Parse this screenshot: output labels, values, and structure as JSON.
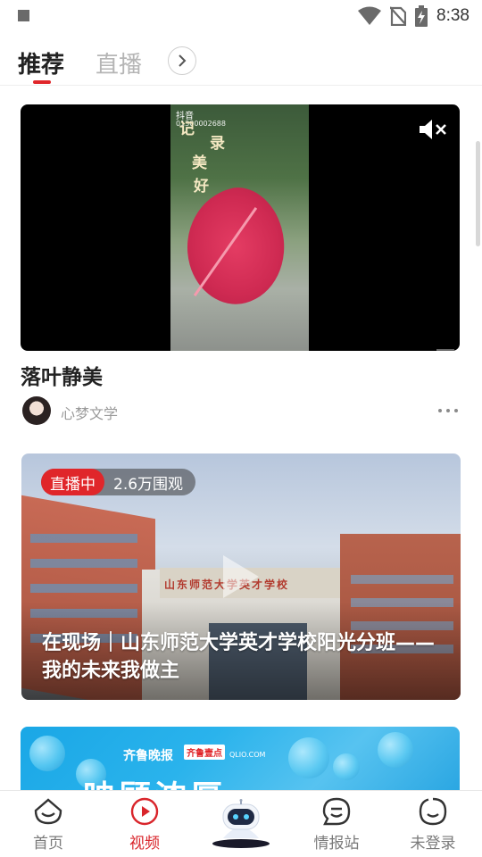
{
  "status_bar": {
    "time": "8:38"
  },
  "tabs": [
    {
      "label": "推荐",
      "active": true
    },
    {
      "label": "直播",
      "active": false
    }
  ],
  "video_card": {
    "title": "落叶静美",
    "author": "心梦文学",
    "overlay": {
      "app_mark": "抖音",
      "account_id": "01300002688",
      "poem_chars": [
        "记",
        "录",
        "美",
        "好"
      ]
    }
  },
  "live_card": {
    "badge": "直播中",
    "viewers": "2.6万围观",
    "sign": "山东师范大学英才学校",
    "title": "在现场｜山东师范大学英才学校阳光分班——我的未来我做主"
  },
  "promo_card": {
    "brand": "齐鲁晚报",
    "sub_brand": "齐鲁壹点",
    "sub_brand_url": "QLIO.COM",
    "headline": "映顾浓厚"
  },
  "bottom_nav": [
    {
      "label": "首页",
      "icon": "home-face-icon",
      "active": false
    },
    {
      "label": "视频",
      "icon": "play-circle-icon",
      "active": true
    },
    {
      "label": "",
      "icon": "robot-icon",
      "active": false
    },
    {
      "label": "情报站",
      "icon": "chat-face-icon",
      "active": false
    },
    {
      "label": "未登录",
      "icon": "user-face-icon",
      "active": false
    }
  ],
  "colors": {
    "accent": "#e0262a",
    "inactive_tab": "#b5b5b5"
  }
}
